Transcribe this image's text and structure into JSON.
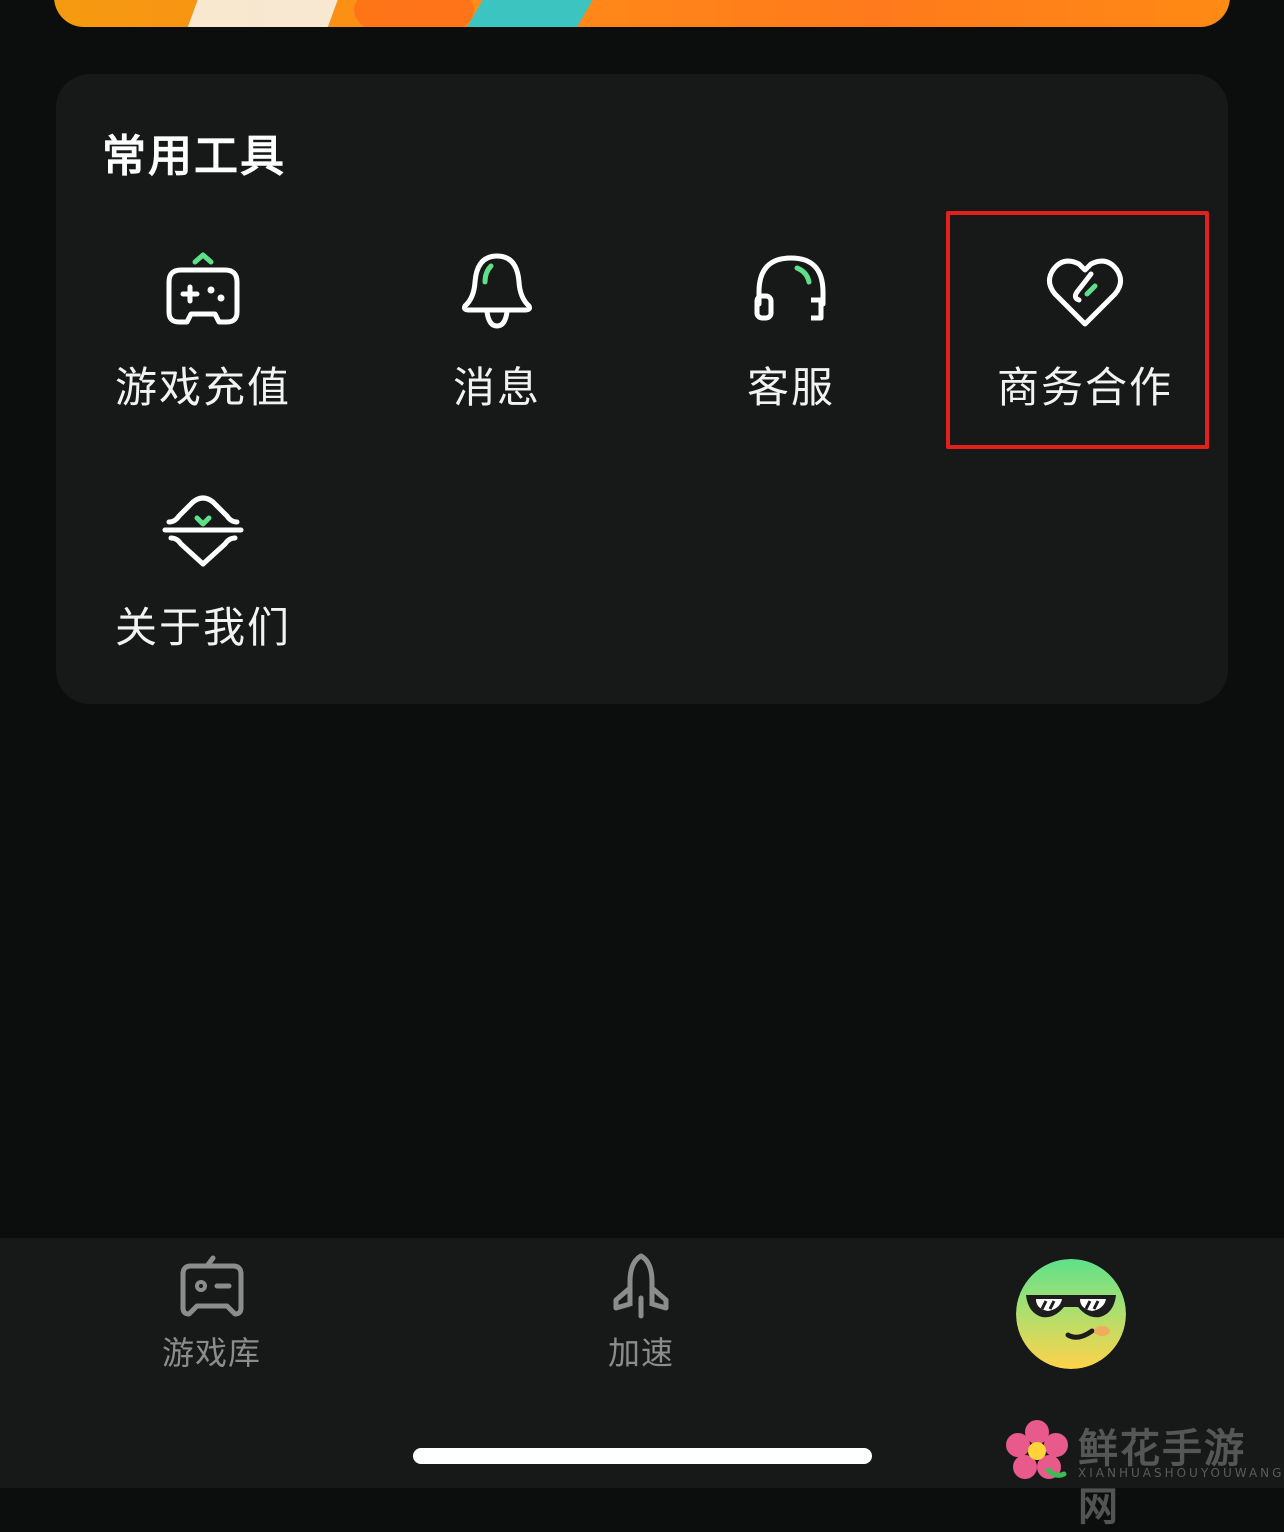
{
  "tools": {
    "title": "常用工具",
    "items": [
      {
        "label": "游戏充值",
        "icon": "gamepad-recharge-icon"
      },
      {
        "label": "消息",
        "icon": "bell-icon"
      },
      {
        "label": "客服",
        "icon": "headset-icon"
      },
      {
        "label": "商务合作",
        "icon": "heart-handshake-icon"
      },
      {
        "label": "关于我们",
        "icon": "about-badge-icon"
      }
    ]
  },
  "tabbar": {
    "items": [
      {
        "label": "游戏库",
        "icon": "game-library-icon"
      },
      {
        "label": "加速",
        "icon": "rocket-icon"
      },
      {
        "label": "",
        "icon": "avatar-icon"
      }
    ]
  },
  "watermark": {
    "title": "鲜花手游网",
    "subtitle": "XIANHUASHOUYOUWANG"
  },
  "colors": {
    "accent_green": "#5ee08a",
    "highlight_red": "#e2211c",
    "banner_orange": "#ff8a18"
  }
}
